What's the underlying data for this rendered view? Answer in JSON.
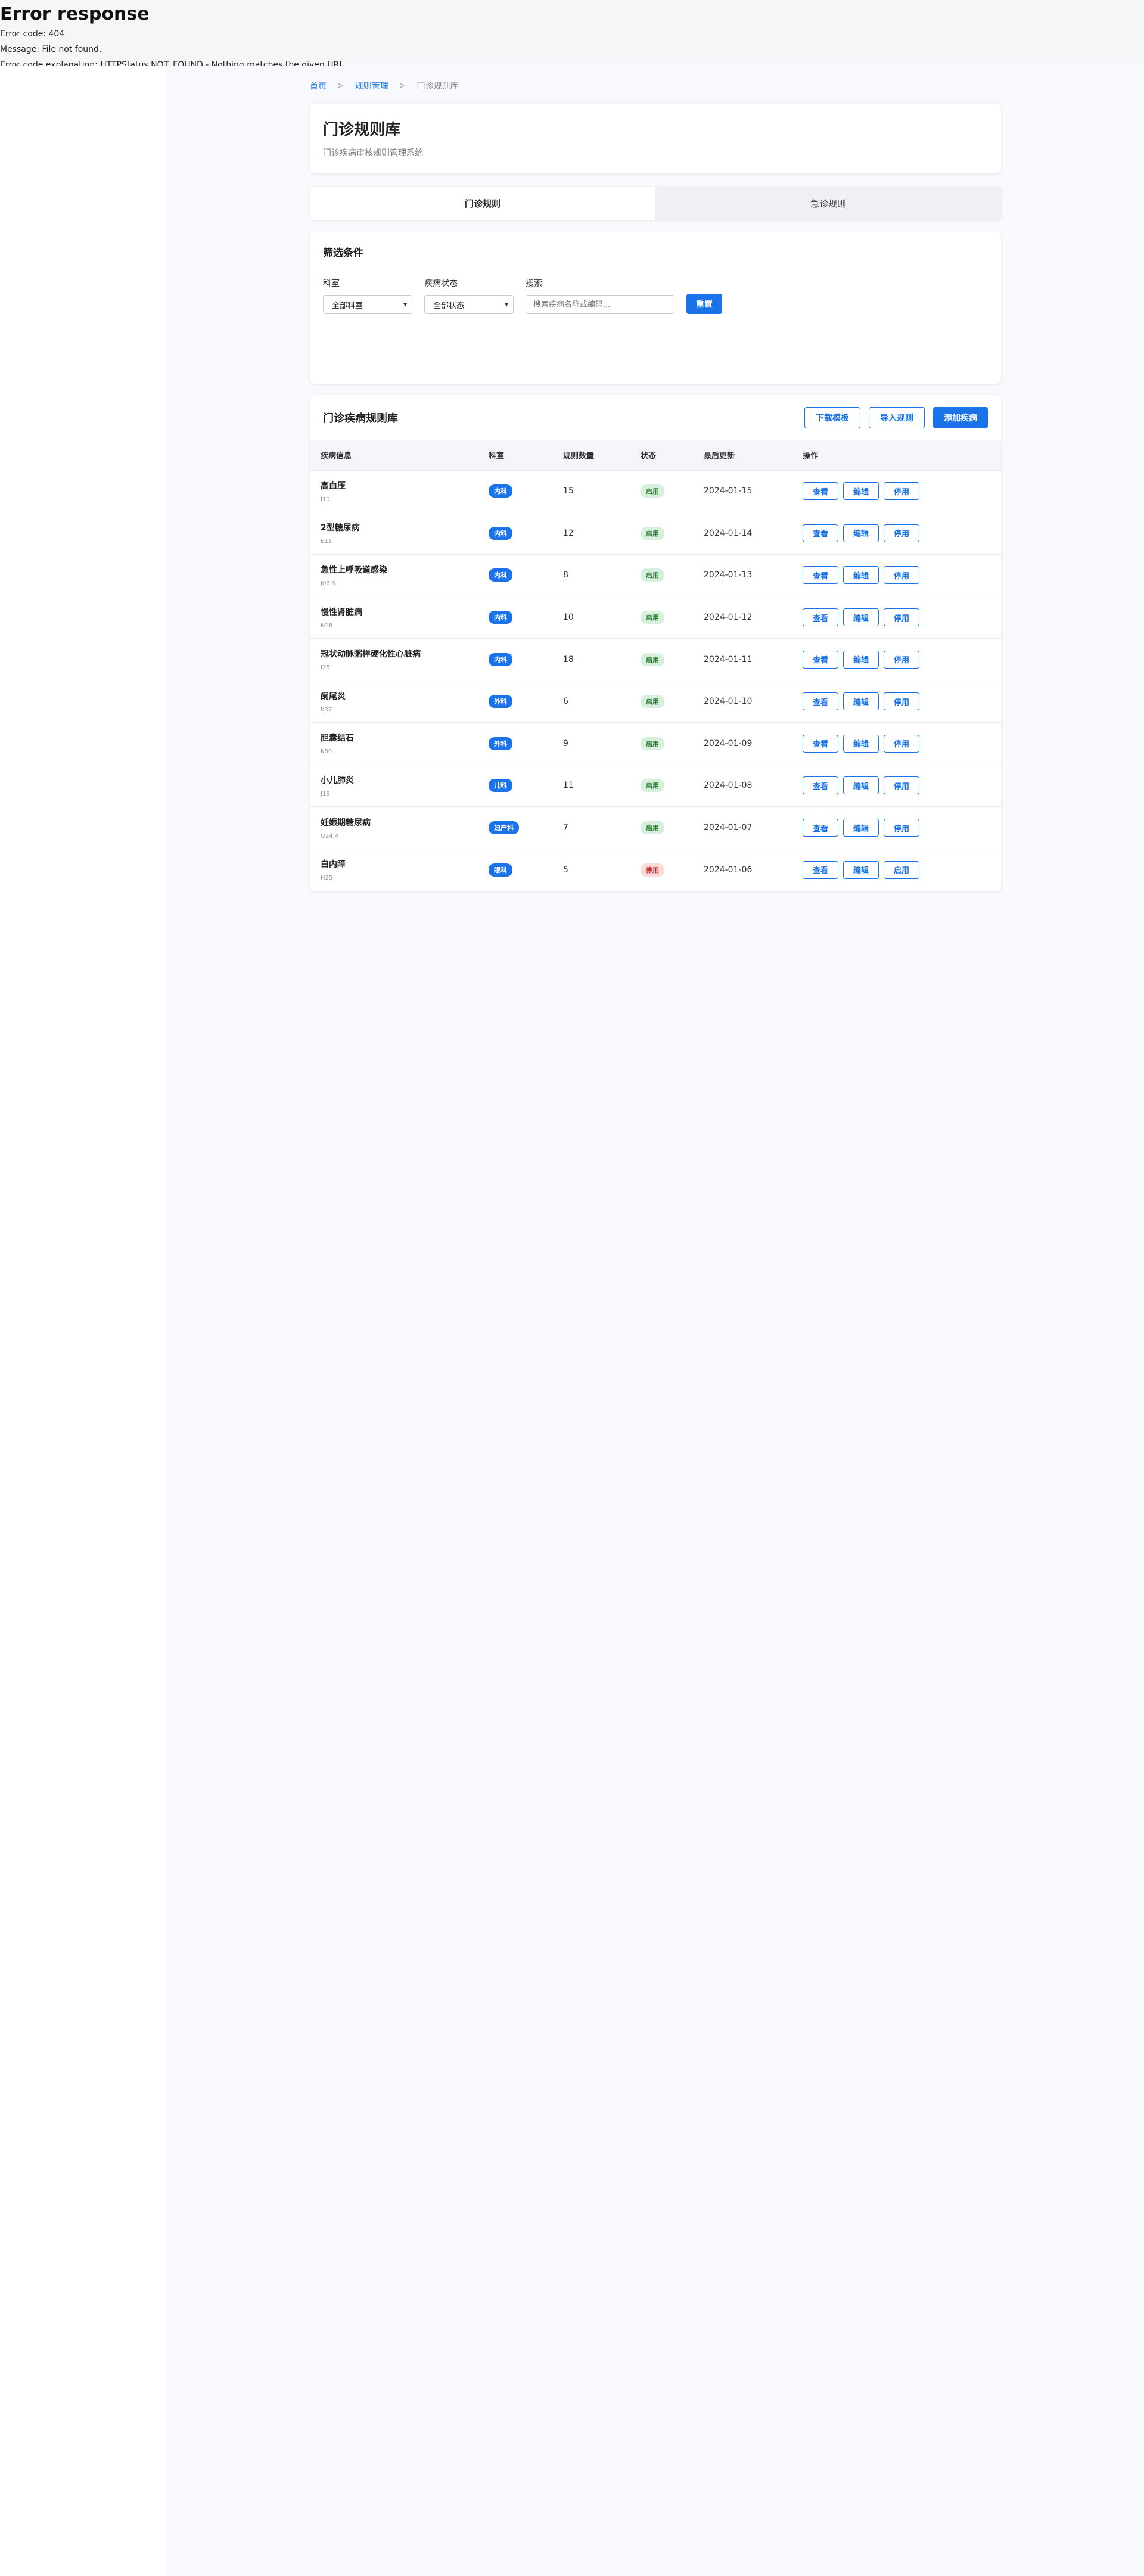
{
  "error": {
    "title": "Error response",
    "code_line": "Error code: 404",
    "message_line": "Message: File not found.",
    "explanation_line": "Error code explanation: HTTPStatus.NOT_FOUND - Nothing matches the given URI."
  },
  "breadcrumb": {
    "items": [
      "首页",
      "规则管理",
      "门诊规则库"
    ],
    "separator": ">"
  },
  "header": {
    "title": "门诊规则库",
    "subtitle": "门诊疾病审核规则管理系统"
  },
  "tabs": [
    {
      "label": "门诊规则",
      "active": true
    },
    {
      "label": "急诊规则",
      "active": false
    }
  ],
  "filters": {
    "title": "筛选条件",
    "dept_label": "科室",
    "dept_value": "全部科室",
    "status_label": "疾病状态",
    "status_value": "全部状态",
    "search_label": "搜索",
    "search_placeholder": "搜索疾病名称或编码...",
    "reset_label": "重置"
  },
  "list": {
    "title": "门诊疾病规则库",
    "download_label": "下载模板",
    "import_label": "导入规则",
    "add_label": "添加疾病",
    "columns": [
      "疾病信息",
      "科室",
      "规则数量",
      "状态",
      "最后更新",
      "操作"
    ],
    "view_label": "查看",
    "edit_label": "编辑",
    "rows": [
      {
        "name": "高血压",
        "code": "I10",
        "dept": "内科",
        "dept_color": "#1a73e8",
        "count": "15",
        "status": "启用",
        "updated": "2024-01-15",
        "toggle": "停用"
      },
      {
        "name": "2型糖尿病",
        "code": "E11",
        "dept": "内科",
        "dept_color": "#1a73e8",
        "count": "12",
        "status": "启用",
        "updated": "2024-01-14",
        "toggle": "停用"
      },
      {
        "name": "急性上呼吸道感染",
        "code": "J06.9",
        "dept": "内科",
        "dept_color": "#1a73e8",
        "count": "8",
        "status": "启用",
        "updated": "2024-01-13",
        "toggle": "停用"
      },
      {
        "name": "慢性肾脏病",
        "code": "N18",
        "dept": "内科",
        "dept_color": "#1a73e8",
        "count": "10",
        "status": "启用",
        "updated": "2024-01-12",
        "toggle": "停用"
      },
      {
        "name": "冠状动脉粥样硬化性心脏病",
        "code": "I25",
        "dept": "内科",
        "dept_color": "#1a73e8",
        "count": "18",
        "status": "启用",
        "updated": "2024-01-11",
        "toggle": "停用"
      },
      {
        "name": "阑尾炎",
        "code": "K37",
        "dept": "外科",
        "dept_color": "#1a73e8",
        "count": "6",
        "status": "启用",
        "updated": "2024-01-10",
        "toggle": "停用"
      },
      {
        "name": "胆囊结石",
        "code": "K80",
        "dept": "外科",
        "dept_color": "#1a73e8",
        "count": "9",
        "status": "启用",
        "updated": "2024-01-09",
        "toggle": "停用"
      },
      {
        "name": "小儿肺炎",
        "code": "J18",
        "dept": "儿科",
        "dept_color": "#1a73e8",
        "count": "11",
        "status": "启用",
        "updated": "2024-01-08",
        "toggle": "停用"
      },
      {
        "name": "妊娠期糖尿病",
        "code": "O24.4",
        "dept": "妇产科",
        "dept_color": "#1a73e8",
        "count": "7",
        "status": "启用",
        "updated": "2024-01-07",
        "toggle": "停用"
      },
      {
        "name": "白内障",
        "code": "H25",
        "dept": "眼科",
        "dept_color": "#1a73e8",
        "count": "5",
        "status": "停用",
        "updated": "2024-01-06",
        "toggle": "启用"
      }
    ]
  },
  "colors": {
    "primary": "#1a73e8",
    "status_enabled_bg": "#d7f0dd",
    "status_enabled_text": "#2e7d32",
    "status_disabled_bg": "#fbdada",
    "status_disabled_text": "#c62828"
  }
}
